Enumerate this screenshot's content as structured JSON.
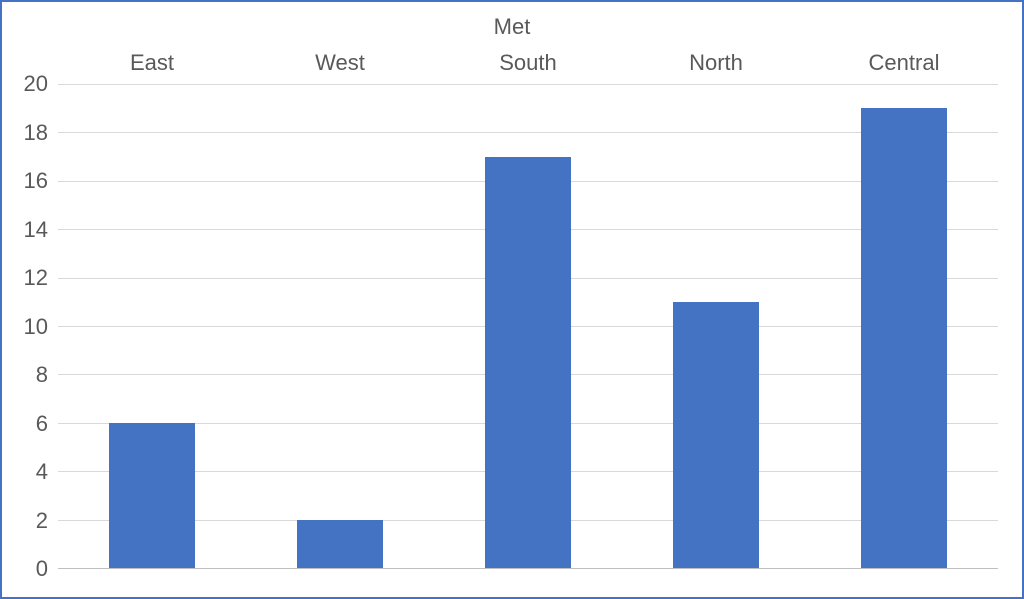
{
  "chart_data": {
    "type": "bar",
    "title": "Met",
    "categories": [
      "East",
      "West",
      "South",
      "North",
      "Central"
    ],
    "values": [
      6,
      2,
      17,
      11,
      19
    ],
    "xlabel": "",
    "ylabel": "",
    "ylim": [
      0,
      20
    ],
    "y_ticks": [
      0,
      2,
      4,
      6,
      8,
      10,
      12,
      14,
      16,
      18,
      20
    ],
    "grid": true,
    "bar_color": "#4473c4"
  },
  "styles": {
    "border_color": "#4472c4",
    "text_color": "#595959",
    "gridline_color": "#d9d9d9"
  }
}
